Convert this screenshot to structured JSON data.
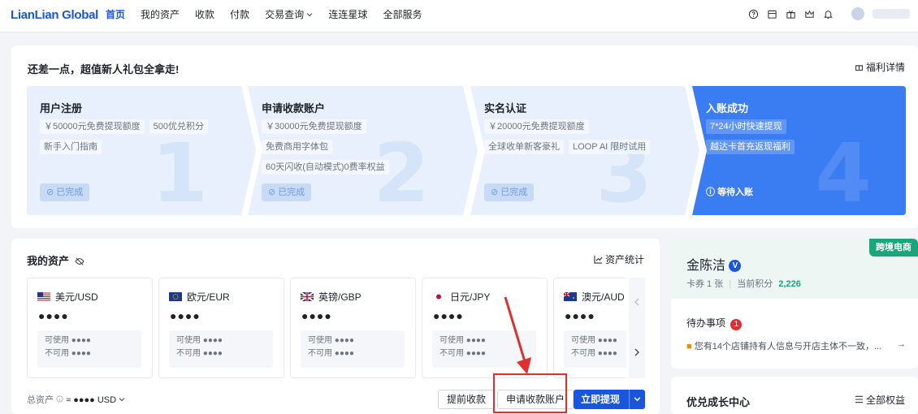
{
  "nav": {
    "logo": "LianLian Global",
    "links": [
      "首页",
      "我的资产",
      "收款",
      "付款",
      "交易查询",
      "连连星球",
      "全部服务"
    ]
  },
  "promo": {
    "title": "还差一点，超值新人礼包全拿走!",
    "welfare": "福利详情",
    "steps": [
      {
        "title": "用户注册",
        "tags": [
          "￥50000元免费提现额度",
          "500优兑积分",
          "新手入门指南"
        ],
        "status": "已完成",
        "num": "1"
      },
      {
        "title": "申请收款账户",
        "tags": [
          "￥30000元免费提现额度",
          "免费商用字体包",
          "60天闪收(自动模式)0费率权益"
        ],
        "status": "已完成",
        "num": "2"
      },
      {
        "title": "实名认证",
        "tags": [
          "￥20000元免费提现额度",
          "全球收单新客豪礼",
          "LOOP AI 限时试用"
        ],
        "status": "已完成",
        "num": "3"
      },
      {
        "title": "入账成功",
        "tags": [
          "7*24小时快速提现",
          "越达卡首充返现福利"
        ],
        "status": "等待入账",
        "num": "4"
      }
    ]
  },
  "assets": {
    "title": "我的资产",
    "stats": "资产统计",
    "currencies": [
      {
        "name": "美元/USD",
        "balance": "●●●●",
        "avail": "可使用",
        "avail_v": "●●●●",
        "unavail": "不可用",
        "unavail_v": "●●●●"
      },
      {
        "name": "欧元/EUR",
        "balance": "●●●●",
        "avail": "可使用",
        "avail_v": "●●●●",
        "unavail": "不可用",
        "unavail_v": "●●●●"
      },
      {
        "name": "英镑/GBP",
        "balance": "●●●●",
        "avail": "可使用",
        "avail_v": "●●●●",
        "unavail": "不可用",
        "unavail_v": "●●●●"
      },
      {
        "name": "日元/JPY",
        "balance": "●●●●",
        "avail": "可使用",
        "avail_v": "●●●●",
        "unavail": "不可用",
        "unavail_v": "●●●●"
      },
      {
        "name": "澳元/AUD",
        "balance": "●●●●",
        "avail": "可使用",
        "avail_v": "●●●●",
        "unavail": "不可用",
        "unavail_v": "●●●●"
      }
    ],
    "total_label": "总资产",
    "total_value": "≈ ●●●● USD",
    "btn_early": "提前收款",
    "btn_apply": "申请收款账户",
    "btn_withdraw": "立即提现"
  },
  "profile": {
    "badge": "跨境电商",
    "name": "金陈洁",
    "vbadge": "V",
    "coupon": "卡券 1 张",
    "points_label": "当前积分",
    "points": "2,226",
    "todo": "待办事项",
    "todo_count": "1",
    "todo_item": "您有14个店铺持有人信息与开店主体不一致，..."
  },
  "growth": {
    "title": "优兑成长中心",
    "all": "全部权益"
  },
  "colors": {
    "accent": "#1a56db",
    "highlight": "#e02f2f",
    "badge": "#1aa67a"
  }
}
